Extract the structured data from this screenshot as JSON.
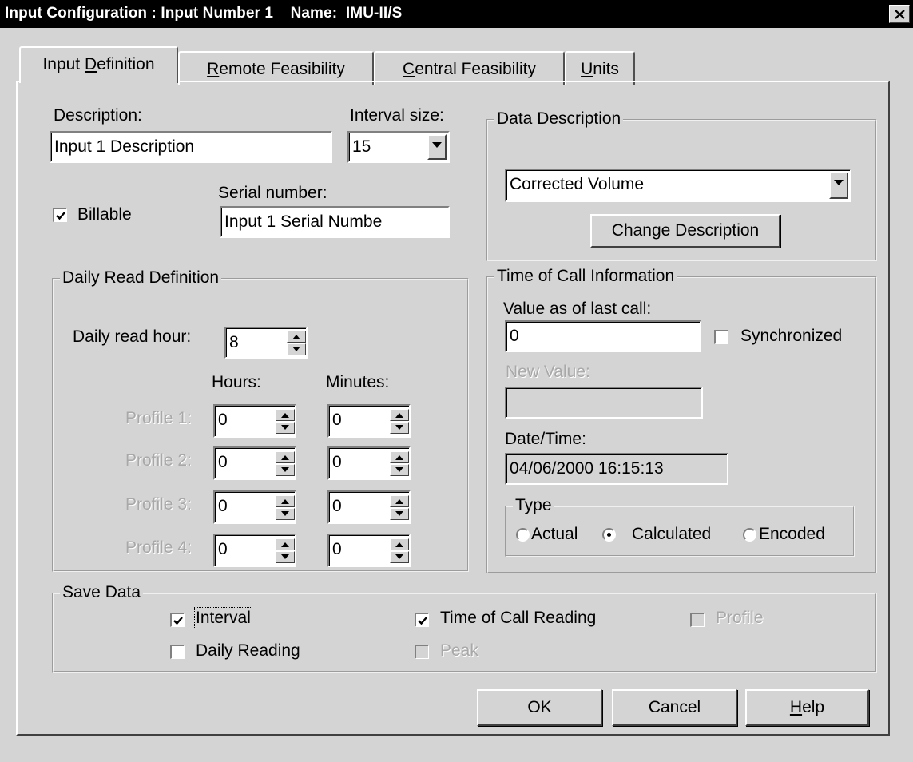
{
  "window": {
    "title": "Input Configuration : Input Number 1    Name:  IMU-II/S",
    "close_glyph": "close-icon"
  },
  "tabs": [
    {
      "label": "Input Definition",
      "mnemonic": "D",
      "active": true
    },
    {
      "label": "Remote Feasibility",
      "mnemonic": "R",
      "active": false
    },
    {
      "label": "Central Feasibility",
      "mnemonic": "C",
      "active": false
    },
    {
      "label": "Units",
      "mnemonic": "U",
      "active": false
    }
  ],
  "general": {
    "description_label": "Description:",
    "description_value": "Input 1 Description",
    "interval_label": "Interval size:",
    "interval_value": "15",
    "billable_label": "Billable",
    "billable_checked": true,
    "serial_label": "Serial number:",
    "serial_value": "Input 1 Serial Numbe"
  },
  "data_description": {
    "legend": "Data Description",
    "selected": "Corrected Volume",
    "change_button": "Change Description"
  },
  "daily_read": {
    "legend": "Daily Read Definition",
    "hour_label": "Daily read hour:",
    "hour_value": "8",
    "hours_header": "Hours:",
    "minutes_header": "Minutes:",
    "profiles": [
      {
        "label": "Profile 1:",
        "hours": "0",
        "minutes": "0"
      },
      {
        "label": "Profile 2:",
        "hours": "0",
        "minutes": "0"
      },
      {
        "label": "Profile 3:",
        "hours": "0",
        "minutes": "0"
      },
      {
        "label": "Profile 4:",
        "hours": "0",
        "minutes": "0"
      }
    ]
  },
  "time_of_call": {
    "legend": "Time of Call Information",
    "value_label": "Value as of last call:",
    "value": "0",
    "synchronized_label": "Synchronized",
    "synchronized_checked": false,
    "new_value_label": "New Value:",
    "new_value": "",
    "datetime_label": "Date/Time:",
    "datetime_value": "04/06/2000 16:15:13",
    "type_legend": "Type",
    "type_options": [
      "Actual",
      "Calculated",
      "Encoded"
    ],
    "type_selected": "Calculated"
  },
  "save_data": {
    "legend": "Save Data",
    "interval": {
      "label": "Interval",
      "checked": true
    },
    "daily_reading": {
      "label": "Daily Reading",
      "checked": false
    },
    "time_of_call_reading": {
      "label": "Time of Call Reading",
      "checked": true
    },
    "peak": {
      "label": "Peak",
      "checked": false,
      "disabled": true
    },
    "profile": {
      "label": "Profile",
      "checked": false,
      "disabled": true
    }
  },
  "buttons": {
    "ok": "OK",
    "cancel": "Cancel",
    "help": "Help"
  }
}
